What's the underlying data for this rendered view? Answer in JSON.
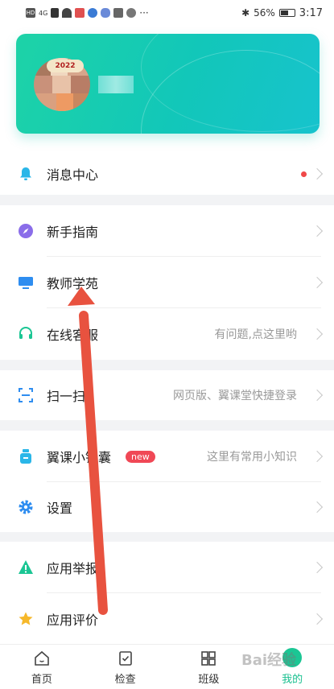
{
  "status_bar": {
    "left_badge": "HD",
    "signal_text": "4G",
    "more_text": "···",
    "battery_text": "56%",
    "time": "3:17"
  },
  "profile": {
    "badge_text": "2022"
  },
  "menu": {
    "message_center": {
      "label": "消息中心"
    },
    "beginner_guide": {
      "label": "新手指南"
    },
    "teacher_academy": {
      "label": "教师学苑"
    },
    "online_service": {
      "label": "在线客服",
      "hint": "有问题,点这里哟"
    },
    "scan": {
      "label": "扫一扫",
      "hint": "网页版、翼课堂快捷登录"
    },
    "tips_bag": {
      "label": "翼课小锦囊",
      "tag": "new",
      "hint": "这里有常用小知识"
    },
    "settings": {
      "label": "设置"
    },
    "report": {
      "label": "应用举报"
    },
    "rating": {
      "label": "应用评价"
    }
  },
  "bottom_nav": {
    "home": "首页",
    "check": "检查",
    "class": "班级",
    "mine": "我的"
  },
  "colors": {
    "accent": "#19c08f",
    "banner_start": "#1dd3a7",
    "banner_end": "#17c3cd",
    "annotation_arrow": "#e8523f"
  },
  "watermark": "Bai经验"
}
